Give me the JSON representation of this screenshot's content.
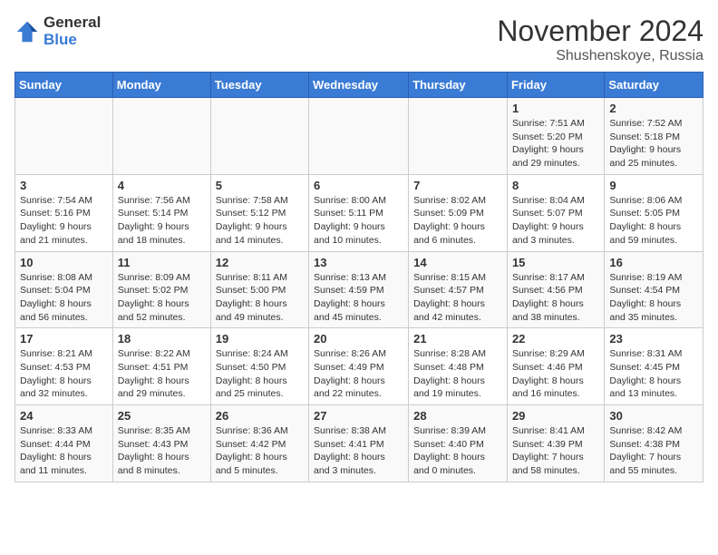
{
  "header": {
    "logo_general": "General",
    "logo_blue": "Blue",
    "month": "November 2024",
    "location": "Shushenskoye, Russia"
  },
  "weekdays": [
    "Sunday",
    "Monday",
    "Tuesday",
    "Wednesday",
    "Thursday",
    "Friday",
    "Saturday"
  ],
  "weeks": [
    [
      {
        "day": "",
        "info": ""
      },
      {
        "day": "",
        "info": ""
      },
      {
        "day": "",
        "info": ""
      },
      {
        "day": "",
        "info": ""
      },
      {
        "day": "",
        "info": ""
      },
      {
        "day": "1",
        "info": "Sunrise: 7:51 AM\nSunset: 5:20 PM\nDaylight: 9 hours and 29 minutes."
      },
      {
        "day": "2",
        "info": "Sunrise: 7:52 AM\nSunset: 5:18 PM\nDaylight: 9 hours and 25 minutes."
      }
    ],
    [
      {
        "day": "3",
        "info": "Sunrise: 7:54 AM\nSunset: 5:16 PM\nDaylight: 9 hours and 21 minutes."
      },
      {
        "day": "4",
        "info": "Sunrise: 7:56 AM\nSunset: 5:14 PM\nDaylight: 9 hours and 18 minutes."
      },
      {
        "day": "5",
        "info": "Sunrise: 7:58 AM\nSunset: 5:12 PM\nDaylight: 9 hours and 14 minutes."
      },
      {
        "day": "6",
        "info": "Sunrise: 8:00 AM\nSunset: 5:11 PM\nDaylight: 9 hours and 10 minutes."
      },
      {
        "day": "7",
        "info": "Sunrise: 8:02 AM\nSunset: 5:09 PM\nDaylight: 9 hours and 6 minutes."
      },
      {
        "day": "8",
        "info": "Sunrise: 8:04 AM\nSunset: 5:07 PM\nDaylight: 9 hours and 3 minutes."
      },
      {
        "day": "9",
        "info": "Sunrise: 8:06 AM\nSunset: 5:05 PM\nDaylight: 8 hours and 59 minutes."
      }
    ],
    [
      {
        "day": "10",
        "info": "Sunrise: 8:08 AM\nSunset: 5:04 PM\nDaylight: 8 hours and 56 minutes."
      },
      {
        "day": "11",
        "info": "Sunrise: 8:09 AM\nSunset: 5:02 PM\nDaylight: 8 hours and 52 minutes."
      },
      {
        "day": "12",
        "info": "Sunrise: 8:11 AM\nSunset: 5:00 PM\nDaylight: 8 hours and 49 minutes."
      },
      {
        "day": "13",
        "info": "Sunrise: 8:13 AM\nSunset: 4:59 PM\nDaylight: 8 hours and 45 minutes."
      },
      {
        "day": "14",
        "info": "Sunrise: 8:15 AM\nSunset: 4:57 PM\nDaylight: 8 hours and 42 minutes."
      },
      {
        "day": "15",
        "info": "Sunrise: 8:17 AM\nSunset: 4:56 PM\nDaylight: 8 hours and 38 minutes."
      },
      {
        "day": "16",
        "info": "Sunrise: 8:19 AM\nSunset: 4:54 PM\nDaylight: 8 hours and 35 minutes."
      }
    ],
    [
      {
        "day": "17",
        "info": "Sunrise: 8:21 AM\nSunset: 4:53 PM\nDaylight: 8 hours and 32 minutes."
      },
      {
        "day": "18",
        "info": "Sunrise: 8:22 AM\nSunset: 4:51 PM\nDaylight: 8 hours and 29 minutes."
      },
      {
        "day": "19",
        "info": "Sunrise: 8:24 AM\nSunset: 4:50 PM\nDaylight: 8 hours and 25 minutes."
      },
      {
        "day": "20",
        "info": "Sunrise: 8:26 AM\nSunset: 4:49 PM\nDaylight: 8 hours and 22 minutes."
      },
      {
        "day": "21",
        "info": "Sunrise: 8:28 AM\nSunset: 4:48 PM\nDaylight: 8 hours and 19 minutes."
      },
      {
        "day": "22",
        "info": "Sunrise: 8:29 AM\nSunset: 4:46 PM\nDaylight: 8 hours and 16 minutes."
      },
      {
        "day": "23",
        "info": "Sunrise: 8:31 AM\nSunset: 4:45 PM\nDaylight: 8 hours and 13 minutes."
      }
    ],
    [
      {
        "day": "24",
        "info": "Sunrise: 8:33 AM\nSunset: 4:44 PM\nDaylight: 8 hours and 11 minutes."
      },
      {
        "day": "25",
        "info": "Sunrise: 8:35 AM\nSunset: 4:43 PM\nDaylight: 8 hours and 8 minutes."
      },
      {
        "day": "26",
        "info": "Sunrise: 8:36 AM\nSunset: 4:42 PM\nDaylight: 8 hours and 5 minutes."
      },
      {
        "day": "27",
        "info": "Sunrise: 8:38 AM\nSunset: 4:41 PM\nDaylight: 8 hours and 3 minutes."
      },
      {
        "day": "28",
        "info": "Sunrise: 8:39 AM\nSunset: 4:40 PM\nDaylight: 8 hours and 0 minutes."
      },
      {
        "day": "29",
        "info": "Sunrise: 8:41 AM\nSunset: 4:39 PM\nDaylight: 7 hours and 58 minutes."
      },
      {
        "day": "30",
        "info": "Sunrise: 8:42 AM\nSunset: 4:38 PM\nDaylight: 7 hours and 55 minutes."
      }
    ]
  ]
}
